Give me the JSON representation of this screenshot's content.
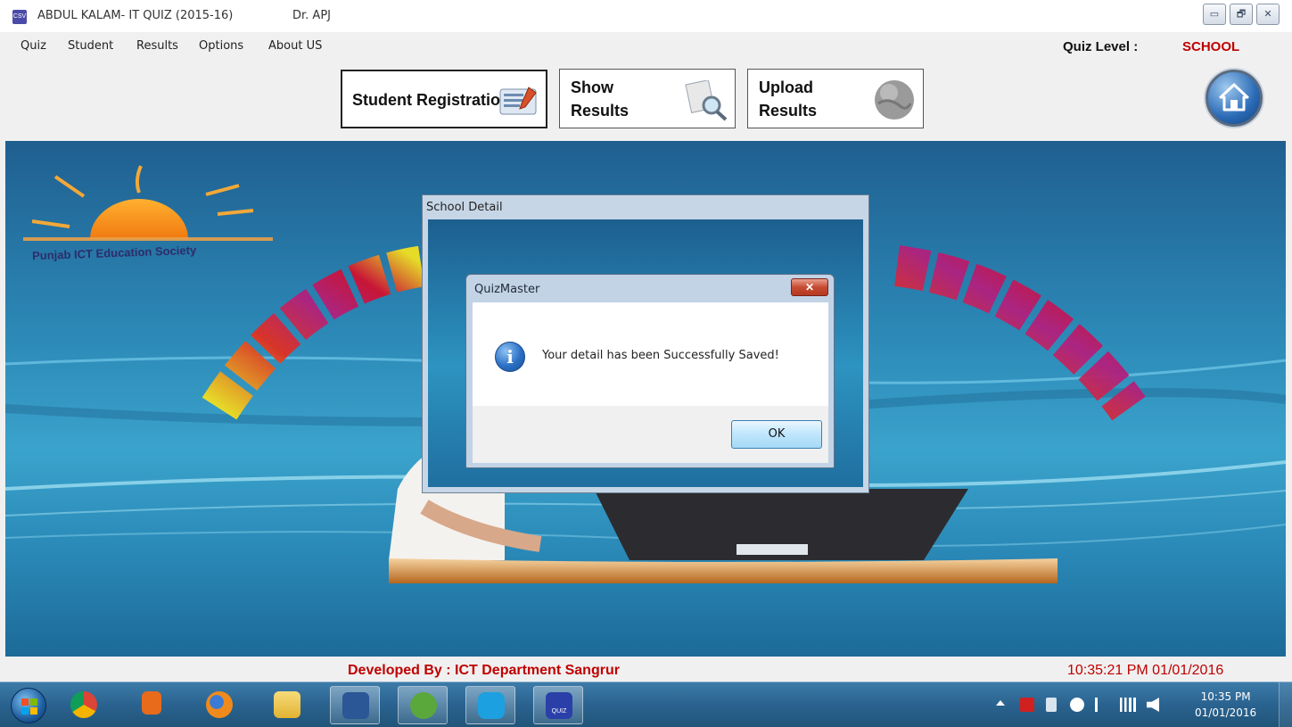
{
  "window": {
    "title": "ABDUL KALAM-  IT QUIZ (2015-16)",
    "title_suffix": "Dr. APJ",
    "app_icon_text": "CSV",
    "controls": {
      "minimize": "▭",
      "maximize": "🗗",
      "close": "✕"
    }
  },
  "menu": {
    "items": [
      {
        "label": "Quiz"
      },
      {
        "label": "Student"
      },
      {
        "label": "Results"
      },
      {
        "label": "Options"
      },
      {
        "label": "About US"
      }
    ],
    "quiz_level_label": "Quiz Level :",
    "quiz_level_value": "SCHOOL"
  },
  "toolbar": {
    "student_registration": "Student Registration",
    "show_results_line1": "Show",
    "show_results_line2": "Results",
    "upload_results_line1": "Upload",
    "upload_results_line2": "Results"
  },
  "banner": {
    "org_name": "Punjab ICT Education Society"
  },
  "school_detail": {
    "title": "School Detail"
  },
  "dialog": {
    "title": "QuizMaster",
    "close_label": "✕",
    "message": "Your detail has been Successfully Saved!",
    "ok_label": "OK",
    "icon_glyph": "i"
  },
  "status": {
    "developed_by": "Developed By :  ICT Department Sangrur",
    "datetime": "10:35:21 PM   01/01/2016"
  },
  "taskbar": {
    "clock_time": "10:35 PM",
    "clock_date": "01/01/2016",
    "quiz_app_label": "QUIZ",
    "colors": {
      "start": "#1f5fa0",
      "chrome": "#e8742c",
      "media": "#e86b1c",
      "firefox": "#f08a1c",
      "explorer": "#f2c94c",
      "word": "#2b5797",
      "utorrent": "#5aa83c",
      "skype": "#1ca0e0",
      "quiz": "#2a3fa8"
    }
  }
}
